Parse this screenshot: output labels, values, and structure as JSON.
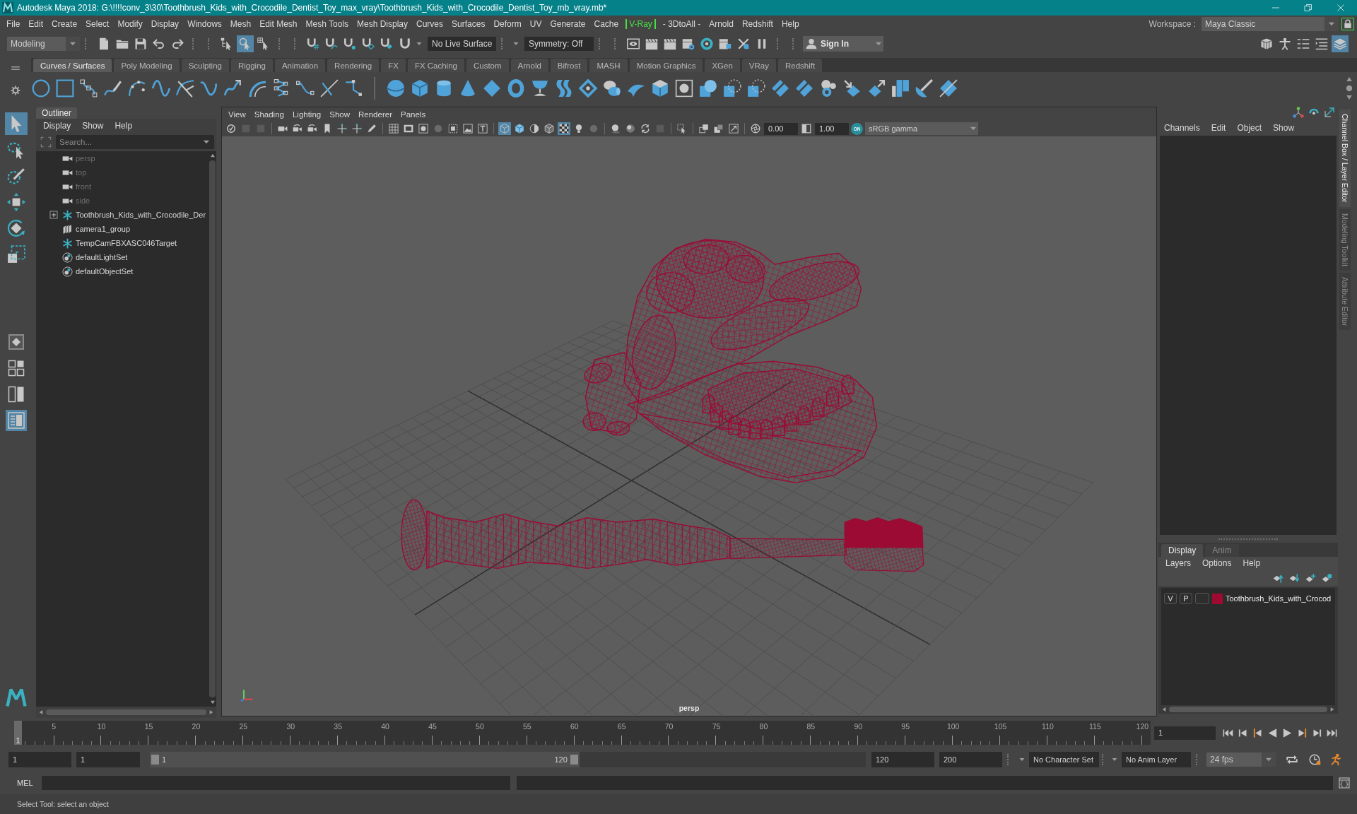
{
  "window": {
    "title": "Autodesk Maya 2018: G:\\!!!!conv_3\\30\\Toothbrush_Kids_with_Crocodile_Dentist_Toy_max_vray\\Toothbrush_Kids_with_Crocodile_Dentist_Toy_mb_vray.mb*"
  },
  "menu_bar": {
    "items": [
      {
        "label": "File",
        "highlighted": false
      },
      {
        "label": "Edit",
        "highlighted": false
      },
      {
        "label": "Create",
        "highlighted": false
      },
      {
        "label": "Select",
        "highlighted": false
      },
      {
        "label": "Modify",
        "highlighted": false
      },
      {
        "label": "Display",
        "highlighted": false
      },
      {
        "label": "Windows",
        "highlighted": false
      },
      {
        "label": "Mesh",
        "highlighted": false
      },
      {
        "label": "Edit Mesh",
        "highlighted": false
      },
      {
        "label": "Mesh Tools",
        "highlighted": false
      },
      {
        "label": "Mesh Display",
        "highlighted": false
      },
      {
        "label": "Curves",
        "highlighted": false
      },
      {
        "label": "Surfaces",
        "highlighted": false
      },
      {
        "label": "Deform",
        "highlighted": false
      },
      {
        "label": "UV",
        "highlighted": false
      },
      {
        "label": "Generate",
        "highlighted": false
      },
      {
        "label": "Cache",
        "highlighted": false
      },
      {
        "label": "V-Ray",
        "highlighted": true
      },
      {
        "label": "- 3DtoAll -",
        "highlighted": false
      },
      {
        "label": "Arnold",
        "highlighted": false
      },
      {
        "label": "Redshift",
        "highlighted": false
      },
      {
        "label": "Help",
        "highlighted": false
      }
    ],
    "workspace_label": "Workspace :",
    "workspace": "Maya Classic",
    "workspace_locked": true
  },
  "status_line": {
    "mode": "Modeling",
    "selection_modes": [
      {
        "selected": false
      },
      {
        "selected": true
      },
      {
        "selected": false
      }
    ],
    "live_surface": "No Live Surface",
    "symmetry": "Symmetry: Off",
    "sign_in": "Sign In",
    "panel_toggles": [
      {
        "selected": false
      },
      {
        "selected": false
      },
      {
        "selected": false
      },
      {
        "selected": false
      },
      {
        "selected": true
      }
    ]
  },
  "shelf": {
    "tabs": [
      {
        "label": "Curves / Surfaces",
        "selected": true
      },
      {
        "label": "Poly Modeling",
        "selected": false
      },
      {
        "label": "Sculpting",
        "selected": false
      },
      {
        "label": "Rigging",
        "selected": false
      },
      {
        "label": "Animation",
        "selected": false
      },
      {
        "label": "Rendering",
        "selected": false
      },
      {
        "label": "FX",
        "selected": false
      },
      {
        "label": "FX Caching",
        "selected": false
      },
      {
        "label": "Custom",
        "selected": false
      },
      {
        "label": "Arnold",
        "selected": false
      },
      {
        "label": "Bifrost",
        "selected": false
      },
      {
        "label": "MASH",
        "selected": false
      },
      {
        "label": "Motion Graphics",
        "selected": false
      },
      {
        "label": "XGen",
        "selected": false
      },
      {
        "label": "VRay",
        "selected": false
      },
      {
        "label": "Redshift",
        "selected": false
      }
    ]
  },
  "toolbox": {
    "tools": [
      {
        "selected": true
      },
      {
        "selected": false
      },
      {
        "selected": false
      },
      {
        "selected": false
      },
      {
        "selected": false
      },
      {
        "selected": false
      }
    ],
    "layouts": [
      {
        "selected": false
      },
      {
        "selected": false
      },
      {
        "selected": false
      },
      {
        "selected": true
      }
    ]
  },
  "outliner": {
    "title": "Outliner",
    "menus": [
      "Display",
      "Show",
      "Help"
    ],
    "search": {
      "placeholder": "Search..."
    },
    "items": [
      {
        "label": "persp",
        "kind": "camera",
        "dimmed": true,
        "expandable": false
      },
      {
        "label": "top",
        "kind": "camera",
        "dimmed": true,
        "expandable": false
      },
      {
        "label": "front",
        "kind": "camera",
        "dimmed": true,
        "expandable": false
      },
      {
        "label": "side",
        "kind": "camera",
        "dimmed": true,
        "expandable": false
      },
      {
        "label": "Toothbrush_Kids_with_Crocodile_Der",
        "kind": "transform",
        "dimmed": false,
        "expandable": true
      },
      {
        "label": "camera1_group",
        "kind": "group",
        "dimmed": false,
        "expandable": false
      },
      {
        "label": "TempCamFBXASC046Target",
        "kind": "transform",
        "dimmed": false,
        "expandable": false
      },
      {
        "label": "defaultLightSet",
        "kind": "set",
        "dimmed": false,
        "expandable": false
      },
      {
        "label": "defaultObjectSet",
        "kind": "set",
        "dimmed": false,
        "expandable": false
      }
    ]
  },
  "viewport": {
    "menus": [
      "View",
      "Shading",
      "Lighting",
      "Show",
      "Renderer",
      "Panels"
    ],
    "shading_toggles": [
      {
        "selected": true
      },
      {
        "selected": false
      },
      {
        "selected": false
      },
      {
        "selected": false
      },
      {
        "selected": true
      }
    ],
    "exposure": "0.00",
    "gamma": "1.00",
    "color_management": "ON",
    "view_transform": "sRGB gamma",
    "camera_label": "persp"
  },
  "channel_box": {
    "menus": [
      "Channels",
      "Edit",
      "Object",
      "Show"
    ]
  },
  "side_tabs": [
    {
      "label": "Channel Box / Layer Editor",
      "selected": true
    },
    {
      "label": "Modeling Toolkit",
      "selected": false
    },
    {
      "label": "Attribute Editor",
      "selected": false
    }
  ],
  "layer_editor": {
    "tabs": [
      {
        "label": "Display",
        "selected": true
      },
      {
        "label": "Anim",
        "selected": false
      }
    ],
    "menus": [
      "Layers",
      "Options",
      "Help"
    ],
    "layers": [
      {
        "visibility": "V",
        "playback": "P",
        "name": "Toothbrush_Kids_with_Crocod",
        "color": "#9e0a30"
      }
    ]
  },
  "time_slider": {
    "ticks": [
      "5",
      "10",
      "15",
      "20",
      "25",
      "30",
      "35",
      "40",
      "45",
      "50",
      "55",
      "60",
      "65",
      "70",
      "75",
      "80",
      "85",
      "90",
      "95",
      "100",
      "105",
      "110",
      "115",
      "120"
    ],
    "current_frame": "1",
    "level": 0,
    "frame_field": "1"
  },
  "range_slider": {
    "start_field": "1",
    "range_start_field": "1",
    "handle_start": "1",
    "handle_end": "120",
    "level": 0.6,
    "range_end_field": "120",
    "end_field": "200",
    "character_set": "No Character Set",
    "anim_layer": "No Anim Layer",
    "fps": "24 fps"
  },
  "command_line": {
    "language": "MEL"
  },
  "help_line": {
    "text": "Select Tool: select an object"
  }
}
